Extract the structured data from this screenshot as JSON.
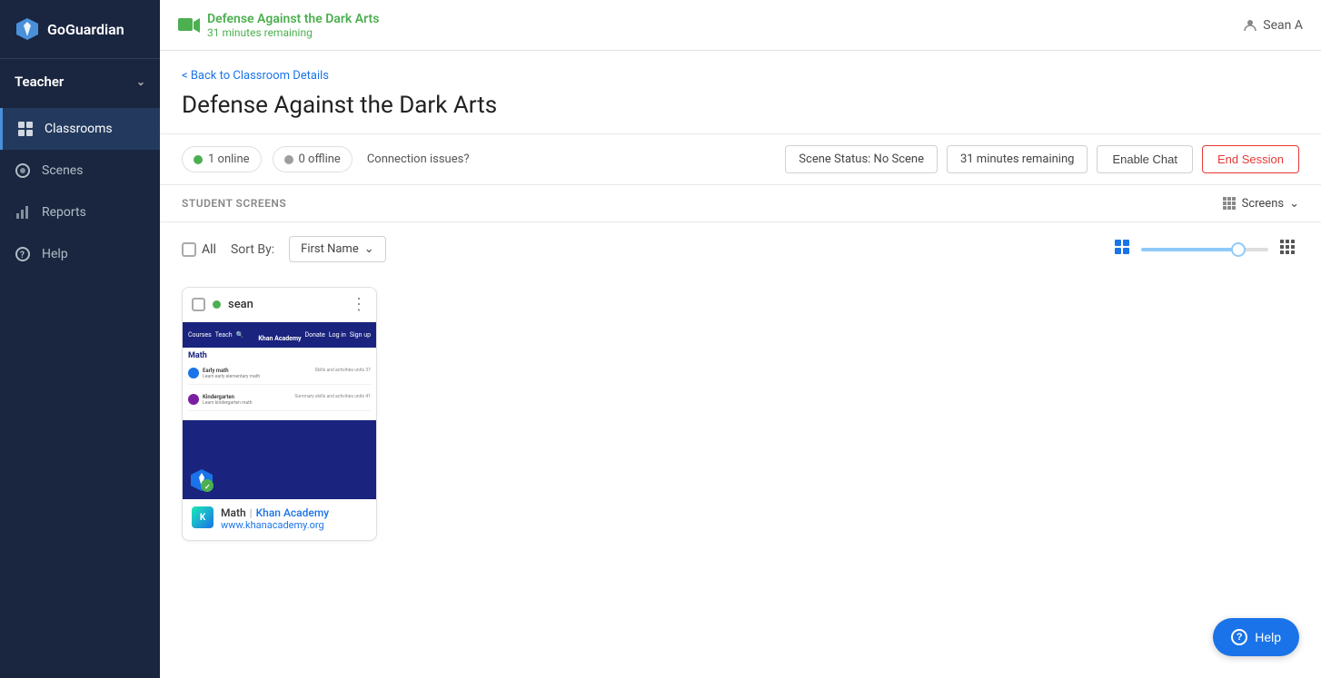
{
  "sidebar": {
    "logo_text": "GoGuardian",
    "teacher_label": "Teacher",
    "nav_items": [
      {
        "id": "classrooms",
        "label": "Classrooms",
        "active": true
      },
      {
        "id": "scenes",
        "label": "Scenes",
        "active": false
      },
      {
        "id": "reports",
        "label": "Reports",
        "active": false
      },
      {
        "id": "help",
        "label": "Help",
        "active": false
      }
    ]
  },
  "topbar": {
    "session_title": "Defense Against the Dark Arts",
    "session_subtitle": "31 minutes remaining",
    "user_name": "Sean A"
  },
  "page": {
    "back_link": "< Back to Classroom Details",
    "title": "Defense Against the Dark Arts",
    "online_count": "1 online",
    "offline_count": "0 offline",
    "connection_issues": "Connection issues?",
    "scene_status": "Scene Status: No Scene",
    "time_remaining": "31 minutes remaining",
    "enable_chat_label": "Enable Chat",
    "end_session_label": "End Session",
    "student_screens_label": "STUDENT SCREENS",
    "screens_label": "Screens",
    "all_label": "All",
    "sort_by_label": "Sort By:",
    "sort_by_value": "First Name"
  },
  "student_card": {
    "name": "sean",
    "site_title": "Math",
    "site_brand": "Khan Academy",
    "site_url": "www.khanacademy.org",
    "subject_title": "Math",
    "rows": [
      {
        "title": "Early math",
        "sub": "Learn early elementary math",
        "meta": "Skills and activities units 37"
      },
      {
        "title": "Kindergarten",
        "sub": "Learn kindergarten math",
        "meta": "Summary skills and activities units 41"
      }
    ]
  },
  "help_button": {
    "label": "Help"
  }
}
